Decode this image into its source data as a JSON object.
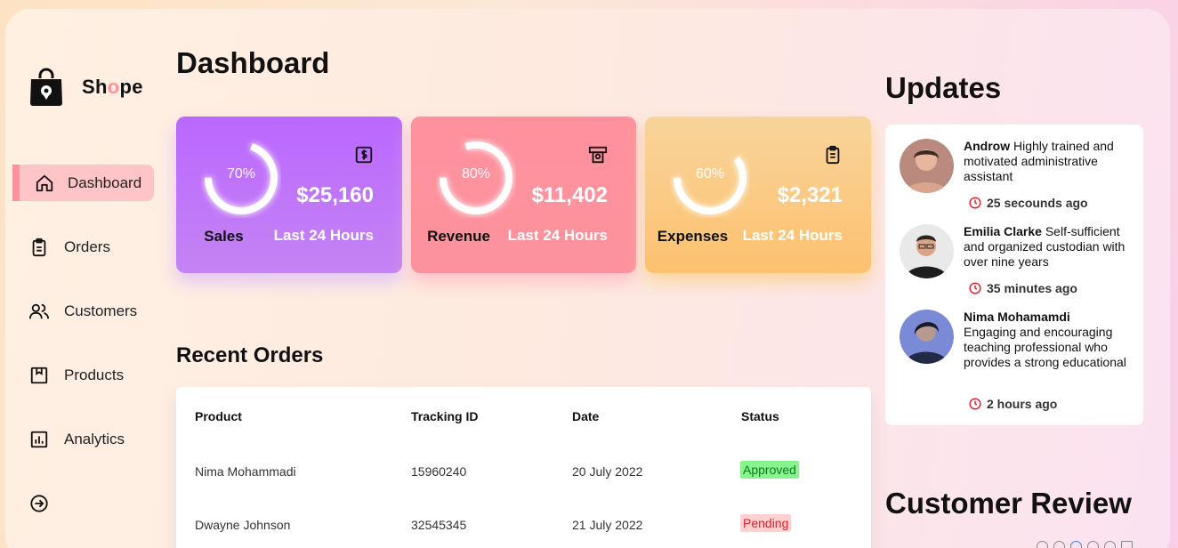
{
  "brand": {
    "name_pre": "Sh",
    "name_accent": "o",
    "name_post": "pe",
    "accent_color": "#ff919d"
  },
  "sidebar": {
    "items": [
      {
        "label": "Dashboard",
        "icon": "home-icon",
        "active": true
      },
      {
        "label": "Orders",
        "icon": "clipboard-icon",
        "active": false
      },
      {
        "label": "Customers",
        "icon": "users-icon",
        "active": false
      },
      {
        "label": "Products",
        "icon": "box-icon",
        "active": false
      },
      {
        "label": "Analytics",
        "icon": "bar-chart-icon",
        "active": false
      }
    ],
    "signout_icon": "sign-out-icon"
  },
  "main": {
    "title": "Dashboard",
    "cards": [
      {
        "name": "Sales",
        "percent": 70,
        "percent_label": "70%",
        "value": "$25,160",
        "period": "Last 24 Hours",
        "icon": "dollar-icon",
        "color": "#bb67ff"
      },
      {
        "name": "Revenue",
        "percent": 80,
        "percent_label": "80%",
        "value": "$11,402",
        "period": "Last 24 Hours",
        "icon": "money-icon",
        "color": "#ff919d"
      },
      {
        "name": "Expenses",
        "percent": 60,
        "percent_label": "60%",
        "value": "$2,321",
        "period": "Last 24 Hours",
        "icon": "clipboard-icon",
        "color": "#fcc86f"
      }
    ],
    "recent_orders": {
      "title": "Recent Orders",
      "headers": [
        "Product",
        "Tracking ID",
        "Date",
        "Status"
      ],
      "rows": [
        {
          "product": "Nima Mohammadi",
          "tracking": "15960240",
          "date": "20 July 2022",
          "status": "Approved"
        },
        {
          "product": "Dwayne Johnson",
          "tracking": "32545345",
          "date": "21 July 2022",
          "status": "Pending"
        }
      ]
    }
  },
  "right": {
    "updates_title": "Updates",
    "updates": [
      {
        "name": "Androw",
        "text": "Highly trained and motivated administrative assistant",
        "time": "25 secounds ago"
      },
      {
        "name": "Emilia Clarke",
        "text": "Self-sufficient and organized custodian with over nine years",
        "time": "35 minutes ago"
      },
      {
        "name": "Nima Mohamamdi",
        "text": "Engaging and encouraging teaching professional who provides a strong educational",
        "time": "2 hours ago"
      }
    ],
    "review_title": "Customer Review"
  }
}
